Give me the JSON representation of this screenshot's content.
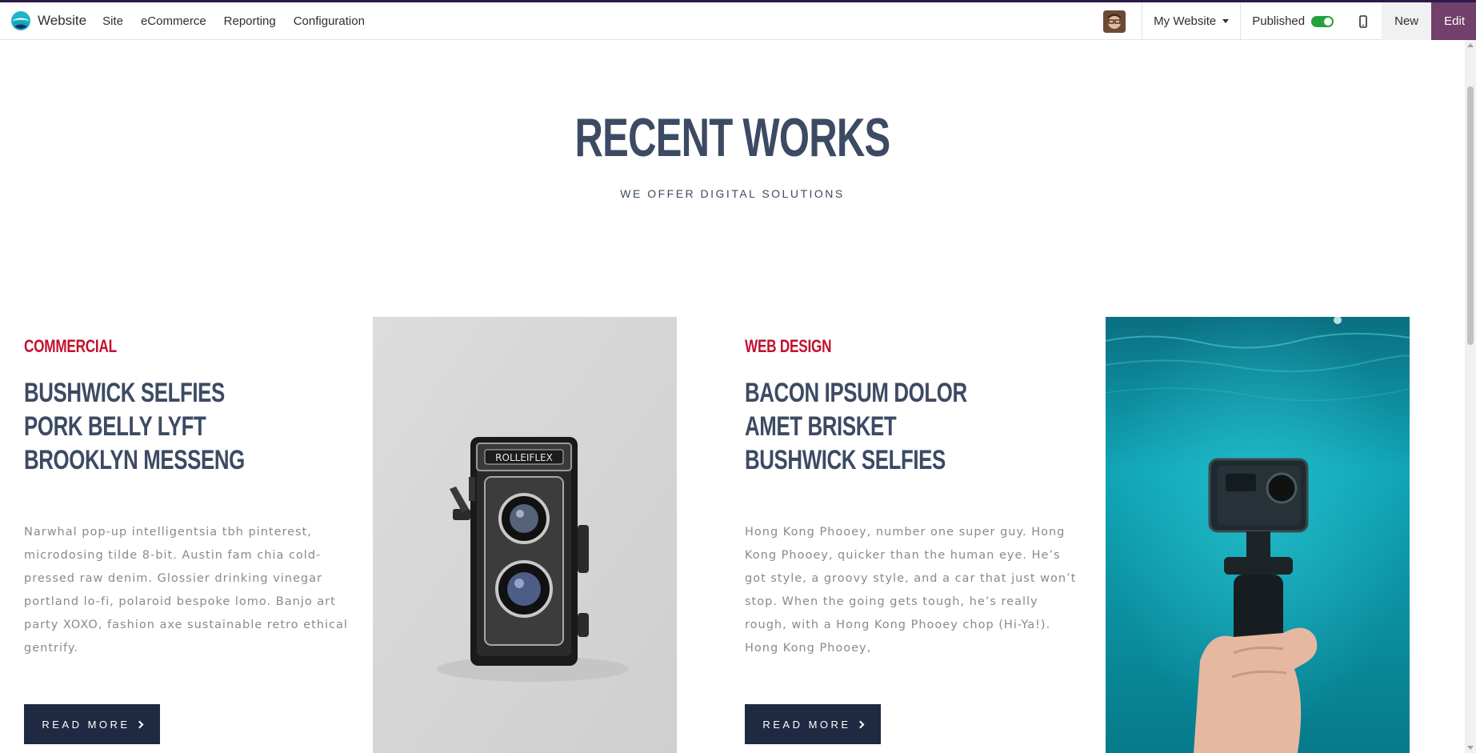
{
  "topbar": {
    "app_name": "Website",
    "menu": [
      "Site",
      "eCommerce",
      "Reporting",
      "Configuration"
    ],
    "website_selector": "My Website",
    "published_label": "Published",
    "published": true,
    "new_label": "New",
    "edit_label": "Edit"
  },
  "section": {
    "title": "RECENT WORKS",
    "subtitle": "WE OFFER DIGITAL SOLUTIONS"
  },
  "cards": [
    {
      "category": "COMMERCIAL",
      "headline": [
        "BUSHWICK SELFIES",
        "PORK BELLY LYFT",
        "BROOKLYN MESSENG"
      ],
      "body": [
        "Narwhal pop-up intelligentsia tbh pinterest,",
        "microdosing tilde 8-bit. Austin fam chia cold-",
        "pressed raw denim. Glossier drinking vinegar",
        "portland lo-fi, polaroid bespoke lomo. Banjo art",
        "party XOXO, fashion axe sustainable retro ethical",
        "gentrify."
      ],
      "button": "READ MORE",
      "image_text": "ROLLEIFLEX"
    },
    {
      "category": "WEB DESIGN",
      "headline": [
        "BACON IPSUM DOLOR",
        "AMET BRISKET",
        "BUSHWICK SELFIES"
      ],
      "body": [
        "Hong Kong Phooey, number one super guy. Hong",
        "Kong Phooey, quicker than the human eye. He’s",
        "got style, a groovy style, and a car that just won’t",
        "stop. When the going gets tough, he’s really",
        "rough, with a Hong Kong Phooey chop (Hi-Ya!).",
        "Hong Kong Phooey,"
      ],
      "button": "READ MORE"
    }
  ],
  "colors": {
    "accent_red": "#c2112d",
    "heading": "#3d4a63",
    "button_bg": "#1f2942",
    "edit_bg": "#71406b",
    "toggle_on": "#21a33b"
  }
}
